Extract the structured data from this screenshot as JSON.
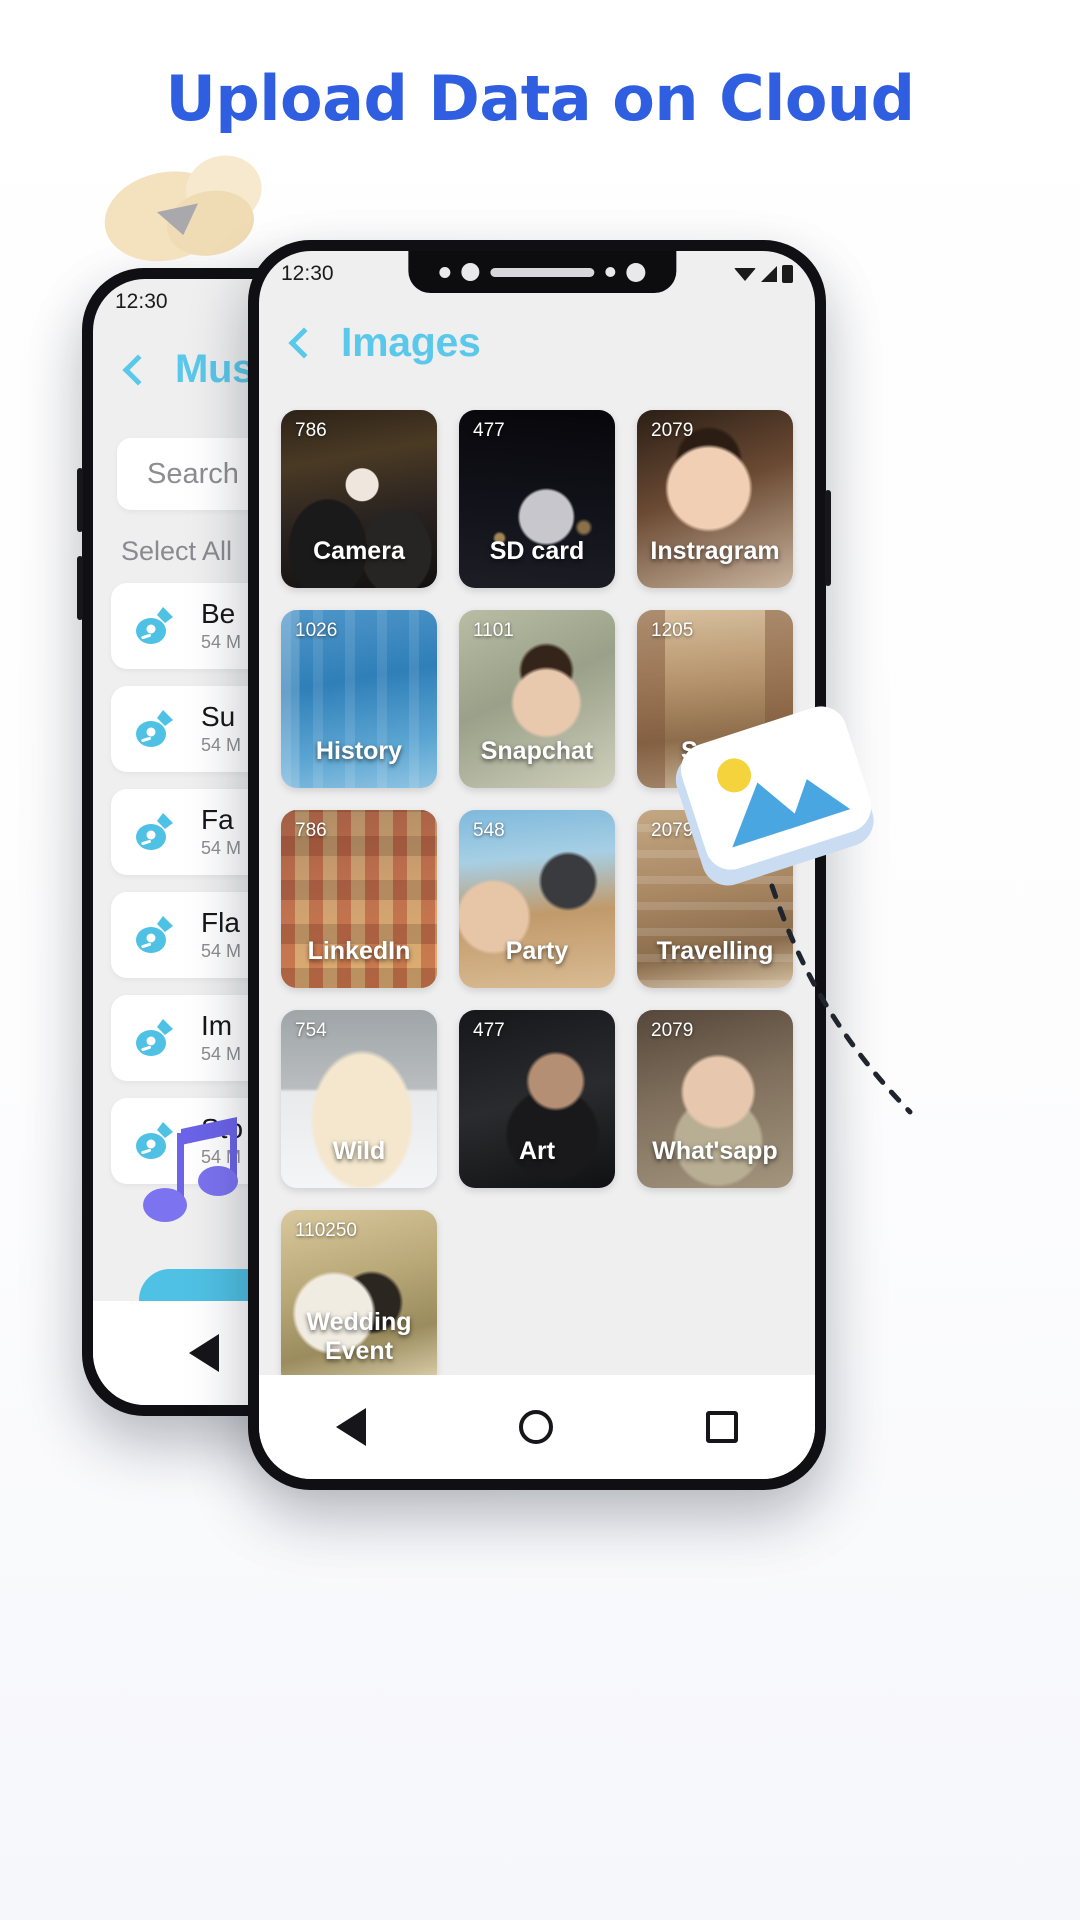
{
  "headline": "Upload Data on Cloud",
  "front_phone": {
    "status": {
      "clock": "12:30",
      "wifi_icon": "wifi-icon",
      "signal_icon": "signal-icon",
      "battery_icon": "battery-icon"
    },
    "header": {
      "back_icon": "chevron-left-icon",
      "title": "Images"
    },
    "nav": {
      "back_icon": "nav-back-triangle-icon",
      "home_icon": "nav-home-circle-icon",
      "recent_icon": "nav-recent-square-icon"
    },
    "tiles": [
      {
        "count": "786",
        "label": "Camera",
        "art": "ph-camera"
      },
      {
        "count": "477",
        "label": "SD card",
        "art": "ph-sdcard"
      },
      {
        "count": "2079",
        "label": "Instragram",
        "art": "ph-instagram"
      },
      {
        "count": "1026",
        "label": "History",
        "art": "ph-history"
      },
      {
        "count": "1101",
        "label": "Snapchat",
        "art": "ph-snapchat"
      },
      {
        "count": "1205",
        "label": "Spain",
        "art": "ph-spain"
      },
      {
        "count": "786",
        "label": "LinkedIn",
        "art": "ph-linkedin"
      },
      {
        "count": "548",
        "label": "Party",
        "art": "ph-party"
      },
      {
        "count": "2079",
        "label": "Travelling",
        "art": "ph-travelling"
      },
      {
        "count": "754",
        "label": "Wild",
        "art": "ph-wild"
      },
      {
        "count": "477",
        "label": "Art",
        "art": "ph-art"
      },
      {
        "count": "2079",
        "label": "What'sapp",
        "art": "ph-whatsapp"
      },
      {
        "count": "110250",
        "label": "Wedding Event",
        "art": "ph-wedding"
      }
    ]
  },
  "back_phone": {
    "status": {
      "clock": "12:30"
    },
    "header": {
      "back_icon": "chevron-left-icon",
      "title": "Music"
    },
    "search": {
      "placeholder": "Search",
      "value": "Search"
    },
    "select_all": "Select All",
    "songs": [
      {
        "name": "Be",
        "size": "54 M"
      },
      {
        "name": "Su",
        "size": "54 M"
      },
      {
        "name": "Fa",
        "size": "54 M"
      },
      {
        "name": "Fla",
        "size": "54 M"
      },
      {
        "name": "Im",
        "size": "54 M"
      },
      {
        "name": "Sto",
        "size": "54 M"
      }
    ],
    "nav": {
      "back_icon": "nav-back-triangle-icon"
    }
  },
  "decor": {
    "upload_icon": "upload-3d-icon",
    "image_card_icon": "image-3d-icon",
    "music_note_icon": "music-note-3d-icon",
    "path_icon": "dotted-path-icon"
  },
  "colors": {
    "headline": "#2f5fe0",
    "accent": "#5ac8ea",
    "pill": "#4fc1e4",
    "screen_bg": "#efeff0"
  }
}
